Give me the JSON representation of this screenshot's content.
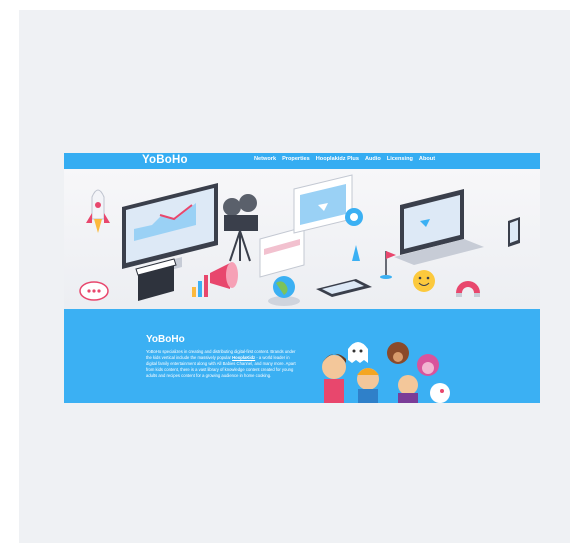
{
  "site": {
    "logo": "YoBoHo",
    "nav": [
      {
        "label": "Network"
      },
      {
        "label": "Properties"
      },
      {
        "label": "Hooplakidz Plus"
      },
      {
        "label": "Audio"
      },
      {
        "label": "Licensing"
      },
      {
        "label": "About"
      }
    ]
  },
  "hero": {
    "description": "isometric illustration of media devices: laptops, monitors, camera, megaphone, clapperboard, globe, magnet"
  },
  "about": {
    "title": "YoBoHo",
    "text_before": "YoBoHo specializes in creating and distributing digital-first content. Brands under the kids vertical include the massively popular ",
    "link": "HooplaKidz",
    "text_after": " - a world leader in digital family entertainment along with All Babies Channel, and many more. Apart from kids content, there is a vast library of knowledge content created for young adults and recipes content for a growing audience in home cooking."
  },
  "colors": {
    "brand_blue": "#35adf2",
    "background": "#eff1f4"
  }
}
